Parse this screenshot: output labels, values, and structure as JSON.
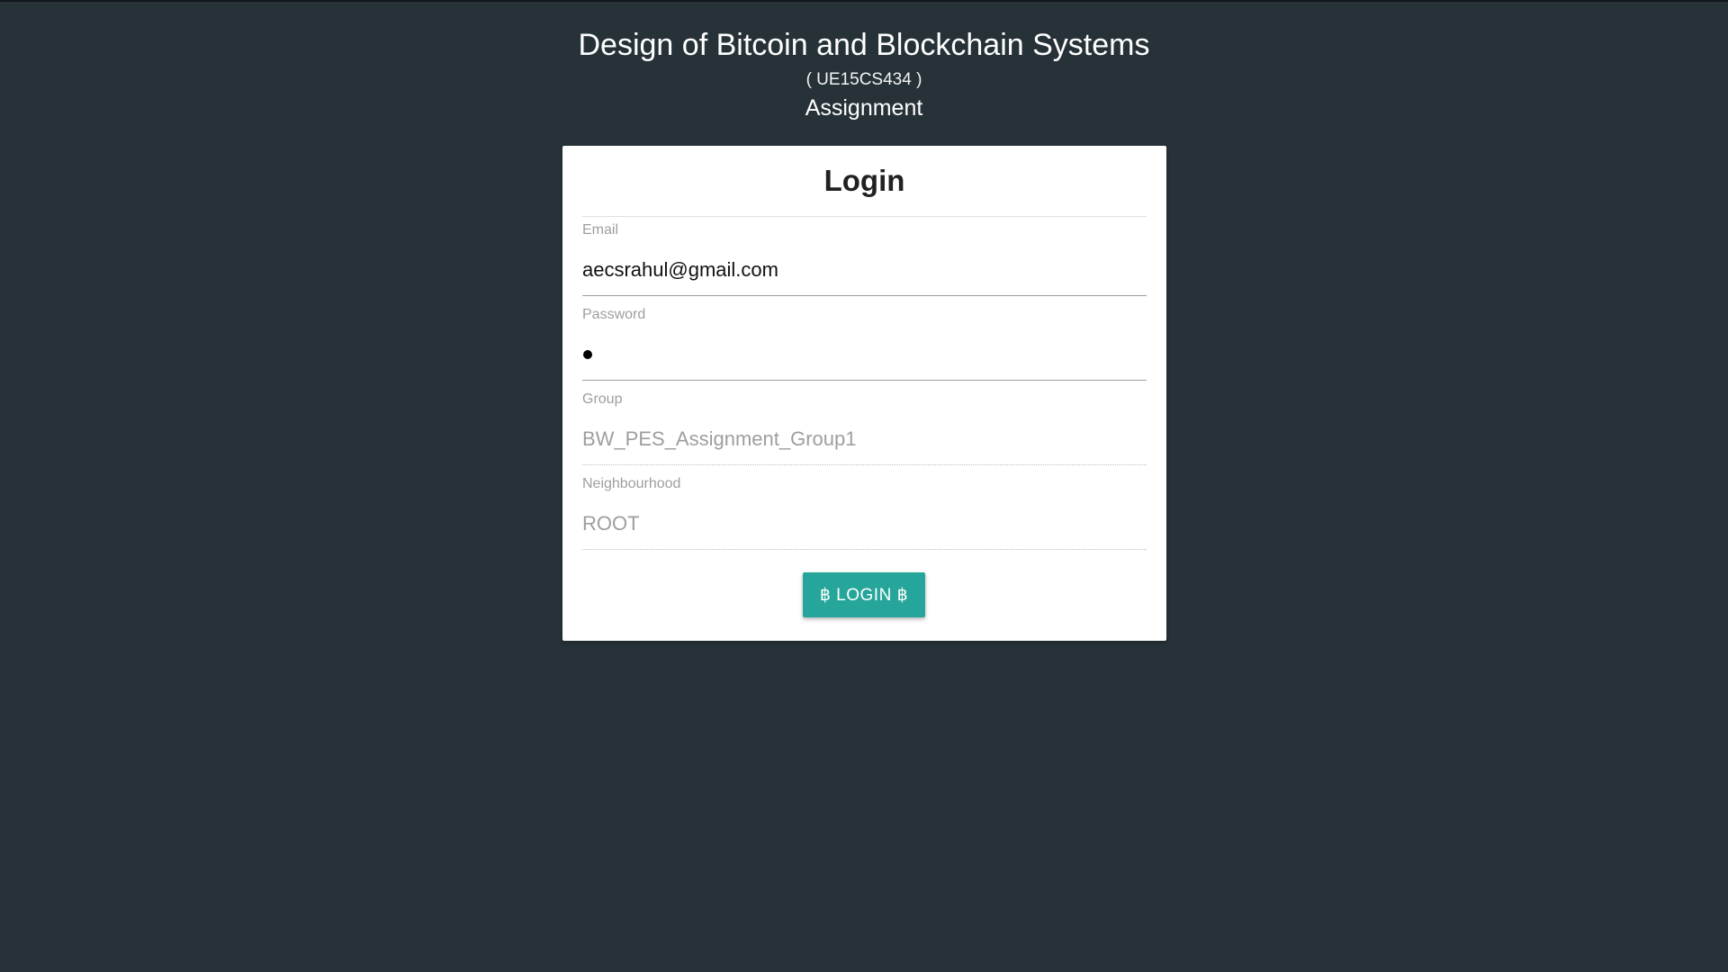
{
  "header": {
    "title": "Design of Bitcoin and Blockchain Systems",
    "course_code": "( UE15CS434 )",
    "subtitle": "Assignment"
  },
  "login_card": {
    "title": "Login",
    "fields": {
      "email": {
        "label": "Email",
        "value": "aecsrahul@gmail.com"
      },
      "password": {
        "label": "Password",
        "masked_value": "•"
      },
      "group": {
        "label": "Group",
        "value": "BW_PES_Assignment_Group1",
        "disabled": true
      },
      "neighbourhood": {
        "label": "Neighbourhood",
        "value": "ROOT",
        "disabled": true
      }
    },
    "submit_label": "฿ LOGIN ฿"
  },
  "colors": {
    "background": "#263238",
    "card": "#ffffff",
    "accent": "#26a69a"
  }
}
